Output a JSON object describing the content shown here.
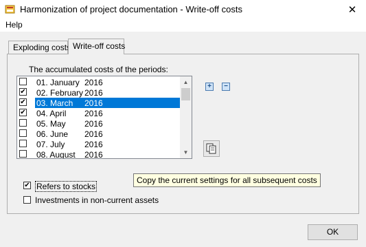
{
  "window": {
    "title": "Harmonization of project documentation - Write-off costs",
    "close_glyph": "✕"
  },
  "menu": {
    "help": "Help"
  },
  "tabs": [
    {
      "label": "Exploding costs"
    },
    {
      "label": "Write-off costs"
    }
  ],
  "periods": {
    "caption": "The accumulated costs of the periods:",
    "items": [
      {
        "month": "01. January",
        "year": "2016",
        "checked": false
      },
      {
        "month": "02. February",
        "year": "2016",
        "checked": true
      },
      {
        "month": "03. March",
        "year": "2016",
        "checked": true
      },
      {
        "month": "04. April",
        "year": "2016",
        "checked": true
      },
      {
        "month": "05. May",
        "year": "2016",
        "checked": false
      },
      {
        "month": "06. June",
        "year": "2016",
        "checked": false
      },
      {
        "month": "07. July",
        "year": "2016",
        "checked": false
      },
      {
        "month": "08. August",
        "year": "2016",
        "checked": false
      }
    ]
  },
  "glyphs": {
    "check": "✔",
    "plus": "+",
    "minus": "−",
    "scroll_up": "▲",
    "scroll_down": "▼"
  },
  "tooltip": {
    "text": "Copy the current settings for all subsequent costs"
  },
  "options": {
    "refers_to_stocks": "Refers to stocks",
    "investments": "Investments in non-current assets"
  },
  "buttons": {
    "ok": "OK"
  },
  "colors": {
    "selection": "#0078d7",
    "tooltip_bg": "#ffffe1"
  }
}
